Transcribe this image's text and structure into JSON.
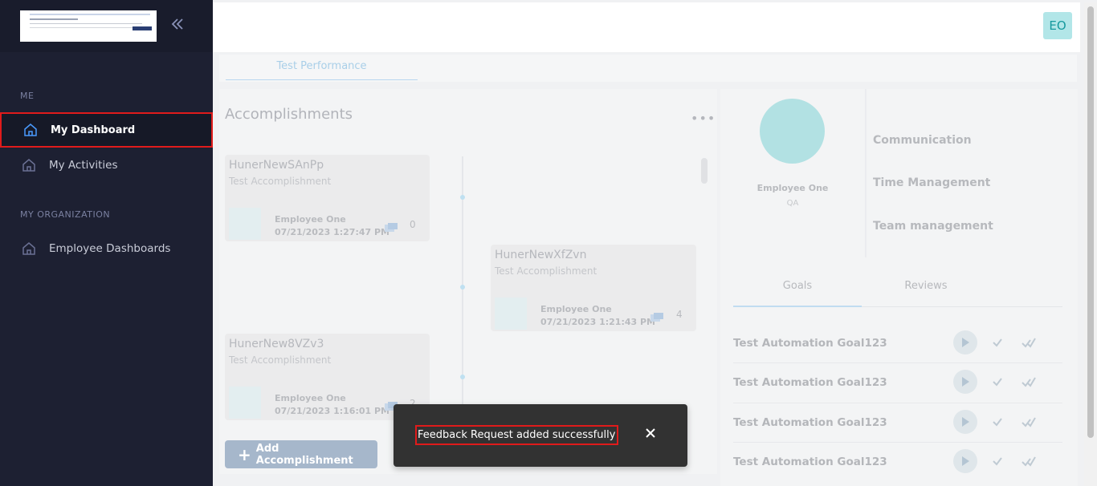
{
  "sidebar": {
    "sections": [
      "ME",
      "MY ORGANIZATION"
    ],
    "items": [
      {
        "label": "My Dashboard",
        "icon": "home-icon",
        "active": true
      },
      {
        "label": "My Activities",
        "icon": "home-icon",
        "active": false
      },
      {
        "label": "Employee Dashboards",
        "icon": "home-icon",
        "active": false
      }
    ],
    "collapse_icon": "double-chevron-left-icon"
  },
  "header": {
    "avatar_initials": "EO"
  },
  "tabs": {
    "performance_label": "Test Performance"
  },
  "accomplishments": {
    "title": "Accomplishments",
    "more_icon": "more-horizontal-icon",
    "add_button_label": "Add Accomplishment",
    "cards": [
      {
        "title": "HunerNewSAnPp",
        "subtitle": "Test Accomplishment",
        "employee": "Employee One",
        "date": "07/21/2023 1:27:47 PM",
        "count": "0"
      },
      {
        "title": "HunerNewXfZvn",
        "subtitle": "Test Accomplishment",
        "employee": "Employee One",
        "date": "07/21/2023 1:21:43 PM",
        "count": "4"
      },
      {
        "title": "HunerNew8VZv3",
        "subtitle": "Test Accomplishment",
        "employee": "Employee One",
        "date": "07/21/2023 1:16:01 PM",
        "count": "2"
      }
    ]
  },
  "profile": {
    "name": "Employee One",
    "role": "QA",
    "skills": [
      "Communication",
      "Time Management",
      "Team management"
    ]
  },
  "goals": {
    "tabs": [
      "Goals",
      "Reviews"
    ],
    "items": [
      "Test Automation Goal123",
      "Test Automation Goal123",
      "Test Automation Goal123",
      "Test Automation Goal123"
    ]
  },
  "toast": {
    "message": "Feedback Request added successfully",
    "close_icon": "close-icon"
  },
  "colors": {
    "sidebar_bg": "#1d2032",
    "highlight": "#e01b1b",
    "accent_teal": "#b2e6e8",
    "toast_bg": "#323232"
  }
}
